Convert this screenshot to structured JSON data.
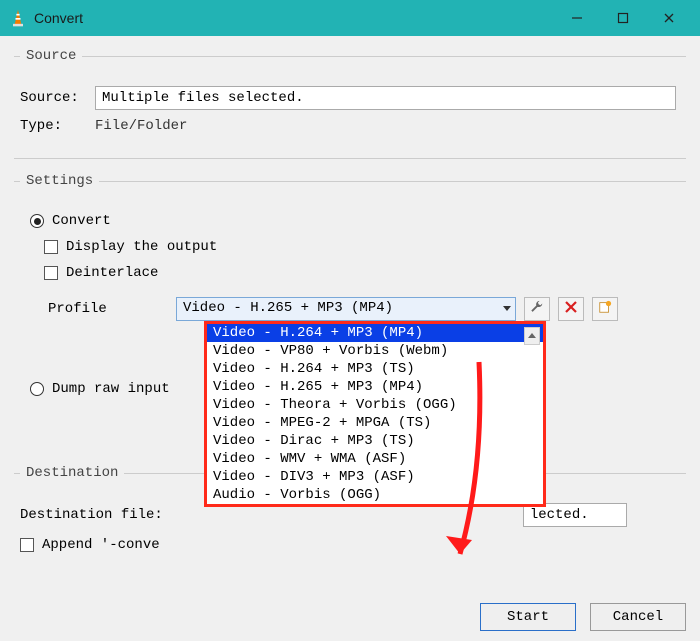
{
  "window": {
    "title": "Convert",
    "controls": {
      "minimize": "–",
      "maximize": "□",
      "close": "✕"
    }
  },
  "source": {
    "legend": "Source",
    "sourceLabel": "Source:",
    "sourceValue": "Multiple files selected.",
    "typeLabel": "Type:",
    "typeValue": "File/Folder"
  },
  "settings": {
    "legend": "Settings",
    "convertLabel": "Convert",
    "displayOutputLabel": "Display the output",
    "deinterlaceLabel": "Deinterlace",
    "profileLabel": "Profile",
    "profileSelected": "Video - H.265 + MP3 (MP4)",
    "dumpRawLabel": "Dump raw input",
    "options": [
      "Video - H.264 + MP3 (MP4)",
      "Video - VP80 + Vorbis (Webm)",
      "Video - H.264 + MP3 (TS)",
      "Video - H.265 + MP3 (MP4)",
      "Video - Theora + Vorbis (OGG)",
      "Video - MPEG-2 + MPGA (TS)",
      "Video - Dirac + MP3 (TS)",
      "Video - WMV + WMA (ASF)",
      "Video - DIV3 + MP3 (ASF)",
      "Audio - Vorbis (OGG)"
    ]
  },
  "destination": {
    "legend": "Destination",
    "destLabel": "Destination file:",
    "destValueTail": "lected.",
    "appendLabel": "Append '-conve"
  },
  "buttons": {
    "start": "Start",
    "cancel": "Cancel"
  },
  "icons": {
    "wrench": "wrench-icon",
    "delete": "delete-icon",
    "new": "new-profile-icon"
  }
}
